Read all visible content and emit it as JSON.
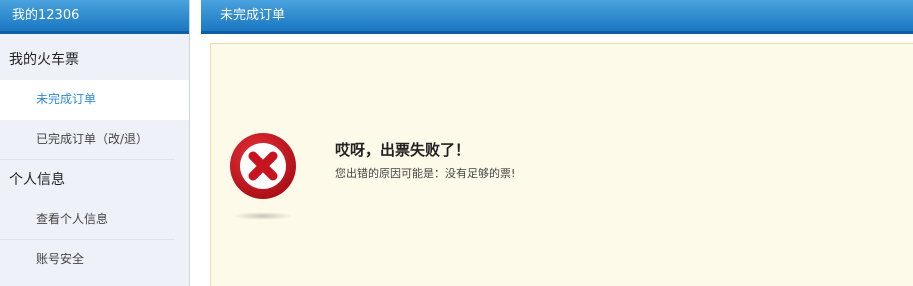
{
  "sidebar": {
    "title": "我的12306",
    "sections": [
      {
        "label": "我的火车票",
        "items": [
          {
            "label": "未完成订单"
          },
          {
            "label": "已完成订单（改/退）"
          }
        ]
      },
      {
        "label": "个人信息",
        "items": [
          {
            "label": "查看个人信息"
          },
          {
            "label": "账号安全"
          }
        ]
      }
    ]
  },
  "main": {
    "title": "未完成订单",
    "error_icon": "error-x-circle-icon",
    "error_title": "哎呀，出票失败了！",
    "error_message": "您出错的原因可能是：没有足够的票!"
  },
  "colors": {
    "header_blue": "#1a77c1",
    "active_link": "#2d8cd6",
    "notice_bg": "#fefae9",
    "error_red": "#c8141e"
  }
}
